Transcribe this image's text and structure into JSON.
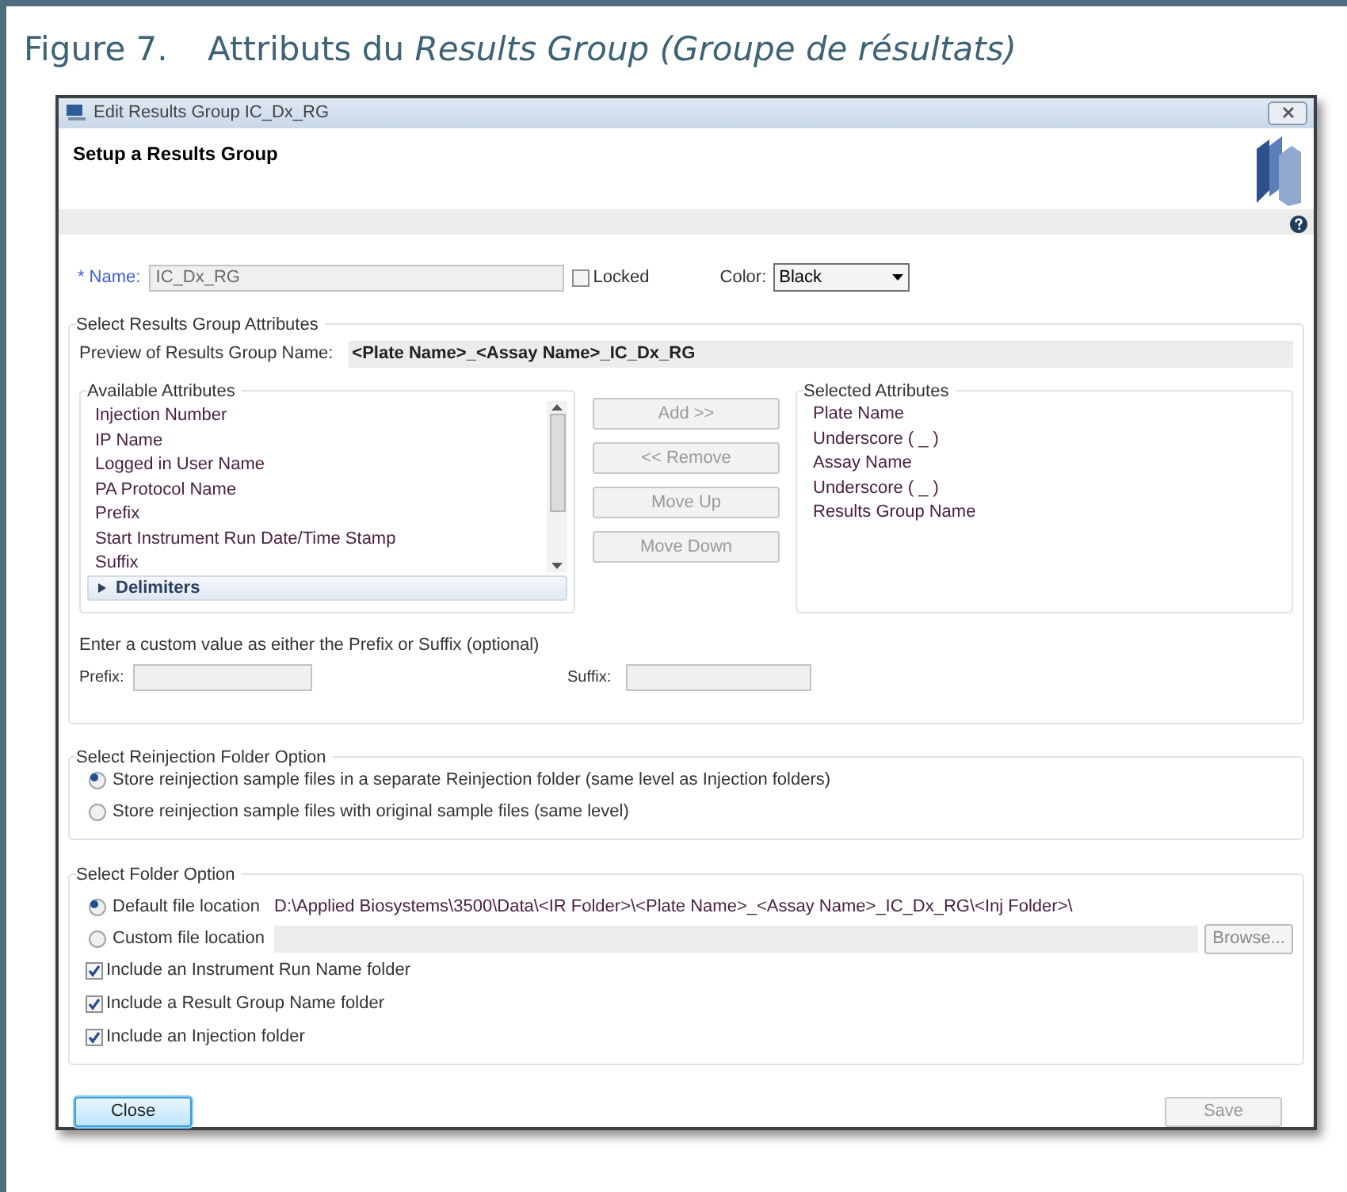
{
  "figure": {
    "number": "Figure 7.",
    "caption": "Attributs du *Results Group (Groupe de résultats)*"
  },
  "window": {
    "title": "Edit Results Group IC_Dx_RG",
    "heading": "Setup a Results Group"
  },
  "name_field": {
    "required_mark": "*",
    "label": "Name:",
    "value": "IC_Dx_RG",
    "disabled": true
  },
  "locked": {
    "label": "Locked",
    "checked": false
  },
  "color_field": {
    "label": "Color:",
    "value": "Black"
  },
  "attributes_group": {
    "title": "Select Results Group Attributes",
    "preview_label": "Preview of Results Group Name:",
    "preview_value": "<Plate Name>_<Assay Name>_IC_Dx_RG",
    "available": {
      "title": "Available Attributes",
      "items": [
        "Injection Number",
        "IP Name",
        "Logged in User Name",
        "PA Protocol Name",
        "Prefix",
        "Start Instrument Run Date/Time Stamp",
        "Suffix"
      ],
      "section": {
        "label": "Delimiters",
        "expanded": false
      }
    },
    "buttons": [
      {
        "label": "Add >>",
        "disabled": true
      },
      {
        "label": "<< Remove",
        "disabled": true
      },
      {
        "label": "Move Up",
        "disabled": true
      },
      {
        "label": "Move Down",
        "disabled": true
      }
    ],
    "selected": {
      "title": "Selected Attributes",
      "items": [
        "Plate Name",
        "Underscore ( _ )",
        "Assay Name",
        "Underscore ( _ )",
        "Results Group Name"
      ]
    },
    "custom_hint": "Enter a custom value as either the Prefix or Suffix (optional)",
    "prefix_label": "Prefix:",
    "suffix_label": "Suffix:"
  },
  "reinjection_group": {
    "title": "Select Reinjection Folder Option",
    "options": [
      {
        "label": "Store reinjection sample files in a separate Reinjection folder (same level as Injection folders)",
        "selected": true
      },
      {
        "label": "Store reinjection sample files with original sample files (same level)",
        "selected": false
      }
    ]
  },
  "folder_group": {
    "title": "Select Folder Option",
    "options": [
      {
        "label": "Default file location",
        "selected": true,
        "kind": "path",
        "value": "D:\\Applied Biosystems\\3500\\Data\\<IR Folder>\\<Plate Name>_<Assay Name>_IC_Dx_RG\\<Inj Folder>\\"
      },
      {
        "label": "Custom file location",
        "selected": false,
        "kind": "field"
      }
    ],
    "browse": "Browse...",
    "checkboxes": [
      {
        "label": "Include an Instrument Run Name folder",
        "checked": true
      },
      {
        "label": "Include a Result Group Name folder",
        "checked": true
      },
      {
        "label": "Include an Injection folder",
        "checked": true
      }
    ]
  },
  "footer_buttons": [
    {
      "label": "Close",
      "disabled": false,
      "focused": true
    },
    {
      "label": "Save",
      "disabled": true,
      "focused": false
    }
  ]
}
